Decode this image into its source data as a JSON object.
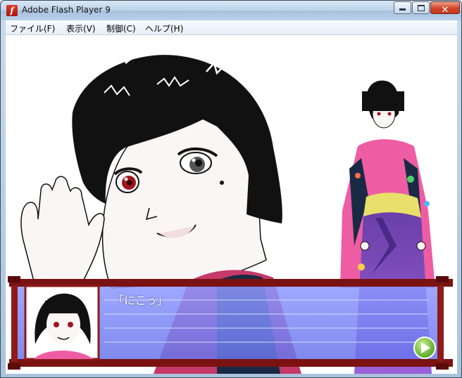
{
  "window": {
    "title": "Adobe Flash Player 9"
  },
  "menu": {
    "items": [
      {
        "label": "ファイル(F)"
      },
      {
        "label": "表示(V)"
      },
      {
        "label": "制御(C)"
      },
      {
        "label": "ヘルプ(H)"
      }
    ]
  },
  "dialog": {
    "text": "「にこっ」"
  },
  "icons": {
    "app": "flash-player-icon",
    "next": "next-arrow-icon"
  },
  "colors": {
    "frame": "#7a1212",
    "message_bg": "#6f7ff2",
    "next_button": "#6bb82a"
  }
}
